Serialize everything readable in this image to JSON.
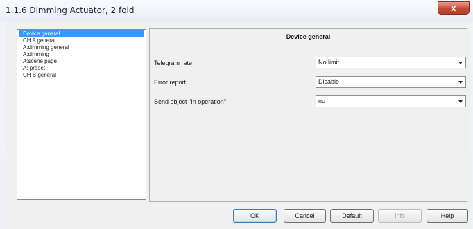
{
  "window": {
    "title": "1.1.6 Dimming Actuator, 2 fold",
    "close_glyph": "x"
  },
  "nav": {
    "items": [
      {
        "label": "Device general",
        "selected": true
      },
      {
        "label": "CH A general",
        "selected": false
      },
      {
        "label": "A:dimming general",
        "selected": false
      },
      {
        "label": "A:dimming",
        "selected": false
      },
      {
        "label": "A:scene page",
        "selected": false
      },
      {
        "label": "A: preset",
        "selected": false
      },
      {
        "label": "CH B general",
        "selected": false
      }
    ]
  },
  "panel": {
    "title": "Device general",
    "params": [
      {
        "label": "Telegram rate",
        "value": "No limit"
      },
      {
        "label": "Error report",
        "value": "Disable"
      },
      {
        "label": "Send object \"In operation\"",
        "value": "no"
      }
    ]
  },
  "buttons": {
    "ok": "OK",
    "cancel": "Cancel",
    "default": "Default",
    "info": "Info",
    "help": "Help"
  },
  "colors": {
    "selection": "#3399ff",
    "close_button": "#c44a35"
  }
}
